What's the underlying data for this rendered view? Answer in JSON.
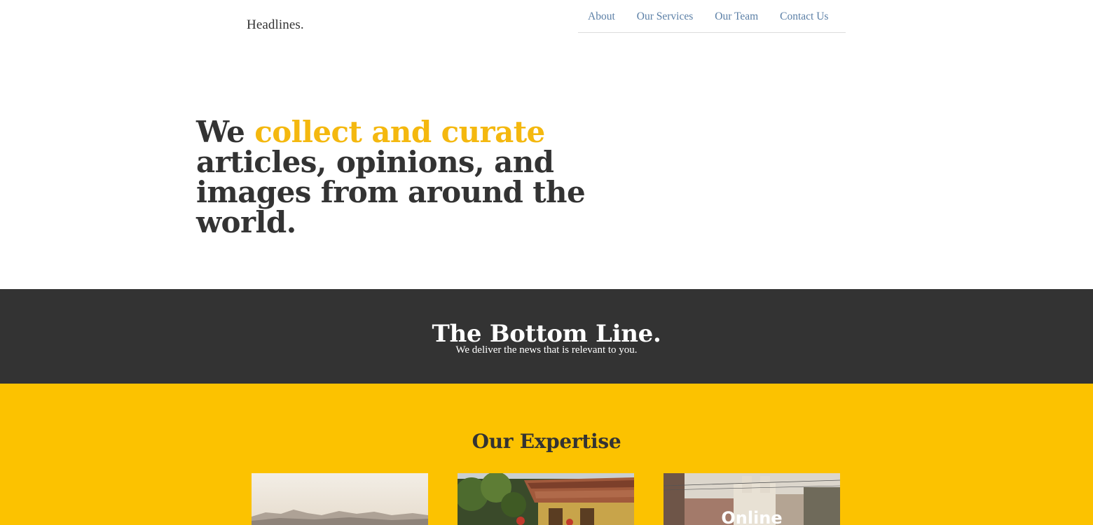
{
  "header": {
    "brand": "Headlines.",
    "nav": [
      "About",
      "Our Services",
      "Our Team",
      "Contact Us"
    ]
  },
  "hero": {
    "prefix": "We ",
    "accent": "collect and curate",
    "suffix": " articles, opinions, and images from around the world."
  },
  "bottom_line": {
    "title": "The Bottom Line.",
    "subtitle": "We deliver the news that is relevant to you."
  },
  "expertise": {
    "title": "Our Expertise",
    "cards": [
      {
        "overlay": ""
      },
      {
        "overlay": ""
      },
      {
        "overlay": "Online"
      }
    ]
  },
  "colors": {
    "accent": "#fcc200",
    "dark_band": "#333333",
    "nav_link": "#5b7fa6",
    "text": "#333333"
  }
}
